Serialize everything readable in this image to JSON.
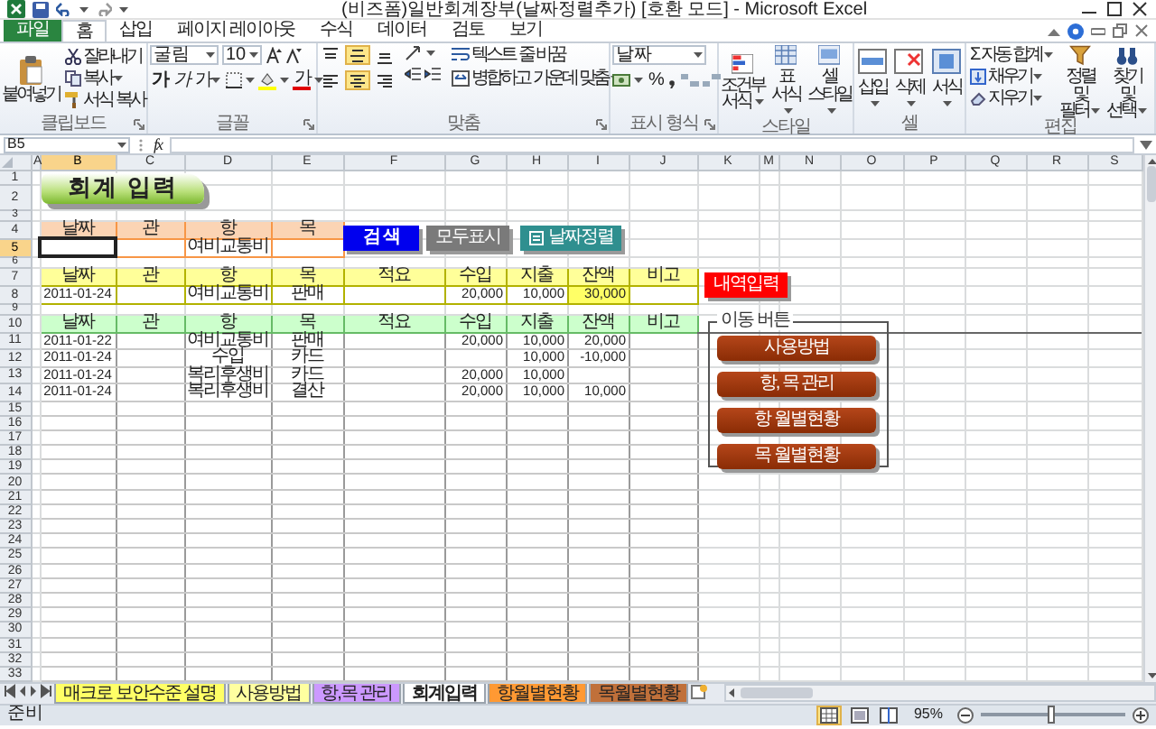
{
  "window": {
    "title": "(비즈폼)일반회계장부(날짜정렬추가) [호환 모드] - Microsoft Excel"
  },
  "ribbon_tabs": [
    {
      "label": "파일",
      "kind": "file",
      "selected": false
    },
    {
      "label": "홈",
      "kind": "tab",
      "selected": true
    },
    {
      "label": "삽입",
      "kind": "tab",
      "selected": false
    },
    {
      "label": "페이지 레이아웃",
      "kind": "tab",
      "selected": false
    },
    {
      "label": "수식",
      "kind": "tab",
      "selected": false
    },
    {
      "label": "데이터",
      "kind": "tab",
      "selected": false
    },
    {
      "label": "검토",
      "kind": "tab",
      "selected": false
    },
    {
      "label": "보기",
      "kind": "tab",
      "selected": false
    }
  ],
  "ribbon": {
    "clipboard": {
      "label": "클립보드",
      "paste": "붙여넣기",
      "cut": "잘라내기",
      "copy": "복사",
      "format_painter": "서식 복사"
    },
    "font": {
      "label": "글꼴",
      "font_name": "굴림",
      "font_size": "10",
      "bold": "가",
      "italic": "가",
      "underline": "가",
      "font_color": "가"
    },
    "alignment": {
      "label": "맞춤",
      "vertical": [
        {
          "selected": false
        },
        {
          "selected": true
        },
        {
          "selected": false
        }
      ],
      "horizontal": [
        {
          "selected": false
        },
        {
          "selected": true
        },
        {
          "selected": false
        }
      ],
      "wrap_text": "텍스트 줄 바꿈",
      "merge": "병합하고 가운데 맞춤"
    },
    "number": {
      "label": "표시 형식",
      "format": "날짜",
      "percent": "%"
    },
    "styles": {
      "label": "스타일",
      "items": [
        "조건부 서식",
        "표 서식",
        "셀 스타일"
      ]
    },
    "cells": {
      "label": "셀",
      "items": [
        "삽입",
        "삭제",
        "서식"
      ]
    },
    "editing": {
      "label": "편집",
      "autosum_symbol": "Σ",
      "autosum": "자동 합계",
      "fill": "채우기",
      "clear": "지우기",
      "sort_filter": "정렬 및 필터",
      "find_select": "찾기 및 선택"
    }
  },
  "formula_bar": {
    "name_box": "B5",
    "function_symbol": "fx"
  },
  "column_headers": [
    {
      "label": "A",
      "selected": false
    },
    {
      "label": "B",
      "selected": true
    },
    {
      "label": "C",
      "selected": false
    },
    {
      "label": "D",
      "selected": false
    },
    {
      "label": "E",
      "selected": false
    },
    {
      "label": "F",
      "selected": false
    },
    {
      "label": "G",
      "selected": false
    },
    {
      "label": "H",
      "selected": false
    },
    {
      "label": "I",
      "selected": false
    },
    {
      "label": "J",
      "selected": false
    },
    {
      "label": "K",
      "selected": false
    },
    {
      "label": "M",
      "selected": false
    },
    {
      "label": "N",
      "selected": false
    },
    {
      "label": "O",
      "selected": false
    },
    {
      "label": "P",
      "selected": false
    },
    {
      "label": "Q",
      "selected": false
    },
    {
      "label": "R",
      "selected": false
    },
    {
      "label": "S",
      "selected": false
    }
  ],
  "row_headers": [
    {
      "label": "1",
      "selected": false
    },
    {
      "label": "2",
      "selected": false
    },
    {
      "label": "3",
      "selected": false
    },
    {
      "label": "4",
      "selected": false
    },
    {
      "label": "5",
      "selected": true
    },
    {
      "label": "6",
      "selected": false
    },
    {
      "label": "7",
      "selected": false
    },
    {
      "label": "8",
      "selected": false
    },
    {
      "label": "9",
      "selected": false
    },
    {
      "label": "10",
      "selected": false
    },
    {
      "label": "11",
      "selected": false
    },
    {
      "label": "12",
      "selected": false
    },
    {
      "label": "13",
      "selected": false
    },
    {
      "label": "14",
      "selected": false
    },
    {
      "label": "15",
      "selected": false
    },
    {
      "label": "16",
      "selected": false
    },
    {
      "label": "17",
      "selected": false
    },
    {
      "label": "18",
      "selected": false
    },
    {
      "label": "19",
      "selected": false
    },
    {
      "label": "20",
      "selected": false
    },
    {
      "label": "21",
      "selected": false
    },
    {
      "label": "22",
      "selected": false
    },
    {
      "label": "23",
      "selected": false
    },
    {
      "label": "24",
      "selected": false
    },
    {
      "label": "25",
      "selected": false
    },
    {
      "label": "26",
      "selected": false
    },
    {
      "label": "27",
      "selected": false
    },
    {
      "label": "28",
      "selected": false
    },
    {
      "label": "29",
      "selected": false
    },
    {
      "label": "30",
      "selected": false
    },
    {
      "label": "31",
      "selected": false
    },
    {
      "label": "32",
      "selected": false
    },
    {
      "label": "33",
      "selected": false
    }
  ],
  "title_banner": "회계 입력",
  "buttons": [
    {
      "label": "검 색",
      "kind": "search"
    },
    {
      "label": "모두표시",
      "kind": "show_all"
    },
    {
      "label": "날짜정렬",
      "kind": "sort_date"
    },
    {
      "label": "내역입력",
      "kind": "entry"
    }
  ],
  "search_table": {
    "headers": [
      "날짜",
      "관",
      "항",
      "목"
    ],
    "cells": [
      {
        "selected": true
      },
      {
        "selected": false
      },
      {
        "text": "여비교통비",
        "selected": false
      },
      {
        "selected": false
      }
    ]
  },
  "entry_table": {
    "headers": [
      "날짜",
      "관",
      "항",
      "목",
      "적요",
      "수입",
      "지출",
      "잔액",
      "비고"
    ],
    "row": {
      "date": "2011-01-24",
      "item": "여비교통비",
      "subitem": "판매",
      "income": "20,000",
      "expense": "10,000",
      "balance": "30,000"
    }
  },
  "list_table": {
    "headers": [
      "날짜",
      "관",
      "항",
      "목",
      "적요",
      "수입",
      "지출",
      "잔액",
      "비고"
    ],
    "rows": [
      {
        "date": "2011-01-22",
        "item": "여비교통비",
        "subitem": "판매",
        "income": "20,000",
        "expense": "10,000",
        "balance": "20,000"
      },
      {
        "date": "2011-01-24",
        "item": "수입",
        "subitem": "카드",
        "expense": "10,000",
        "balance": "-10,000"
      },
      {
        "date": "2011-01-24",
        "item": "복리후생비",
        "subitem": "카드",
        "income": "20,000",
        "expense": "10,000"
      },
      {
        "date": "2011-01-24",
        "item": "복리후생비",
        "subitem": "결산",
        "income": "20,000",
        "expense": "10,000",
        "balance": "10,000"
      }
    ]
  },
  "nav_panel": {
    "label": "이동 버튼",
    "buttons": [
      "사용방법",
      "항, 목 관리",
      "항 월별현황",
      "목 월별현황"
    ]
  },
  "sheet_tabs": [
    {
      "label": "매크로 보안수준 설명",
      "color": "#ffff66",
      "selected": false
    },
    {
      "label": "사용방법",
      "color": "#ffffa0",
      "selected": false
    },
    {
      "label": "항,목 관리",
      "color": "#cc99ff",
      "selected": false
    },
    {
      "label": "회계입력",
      "color": "#ffffff",
      "selected": true
    },
    {
      "label": "항월별현황",
      "color": "#ff9933",
      "selected": false
    },
    {
      "label": "목월별현황",
      "color": "#c0703a",
      "selected": false
    }
  ],
  "status_bar": {
    "ready": "준비",
    "views": [
      {
        "selected": true
      },
      {
        "selected": false
      },
      {
        "selected": false
      }
    ],
    "zoom": "95%",
    "zoom_slider": {
      "level": 0.49
    }
  }
}
